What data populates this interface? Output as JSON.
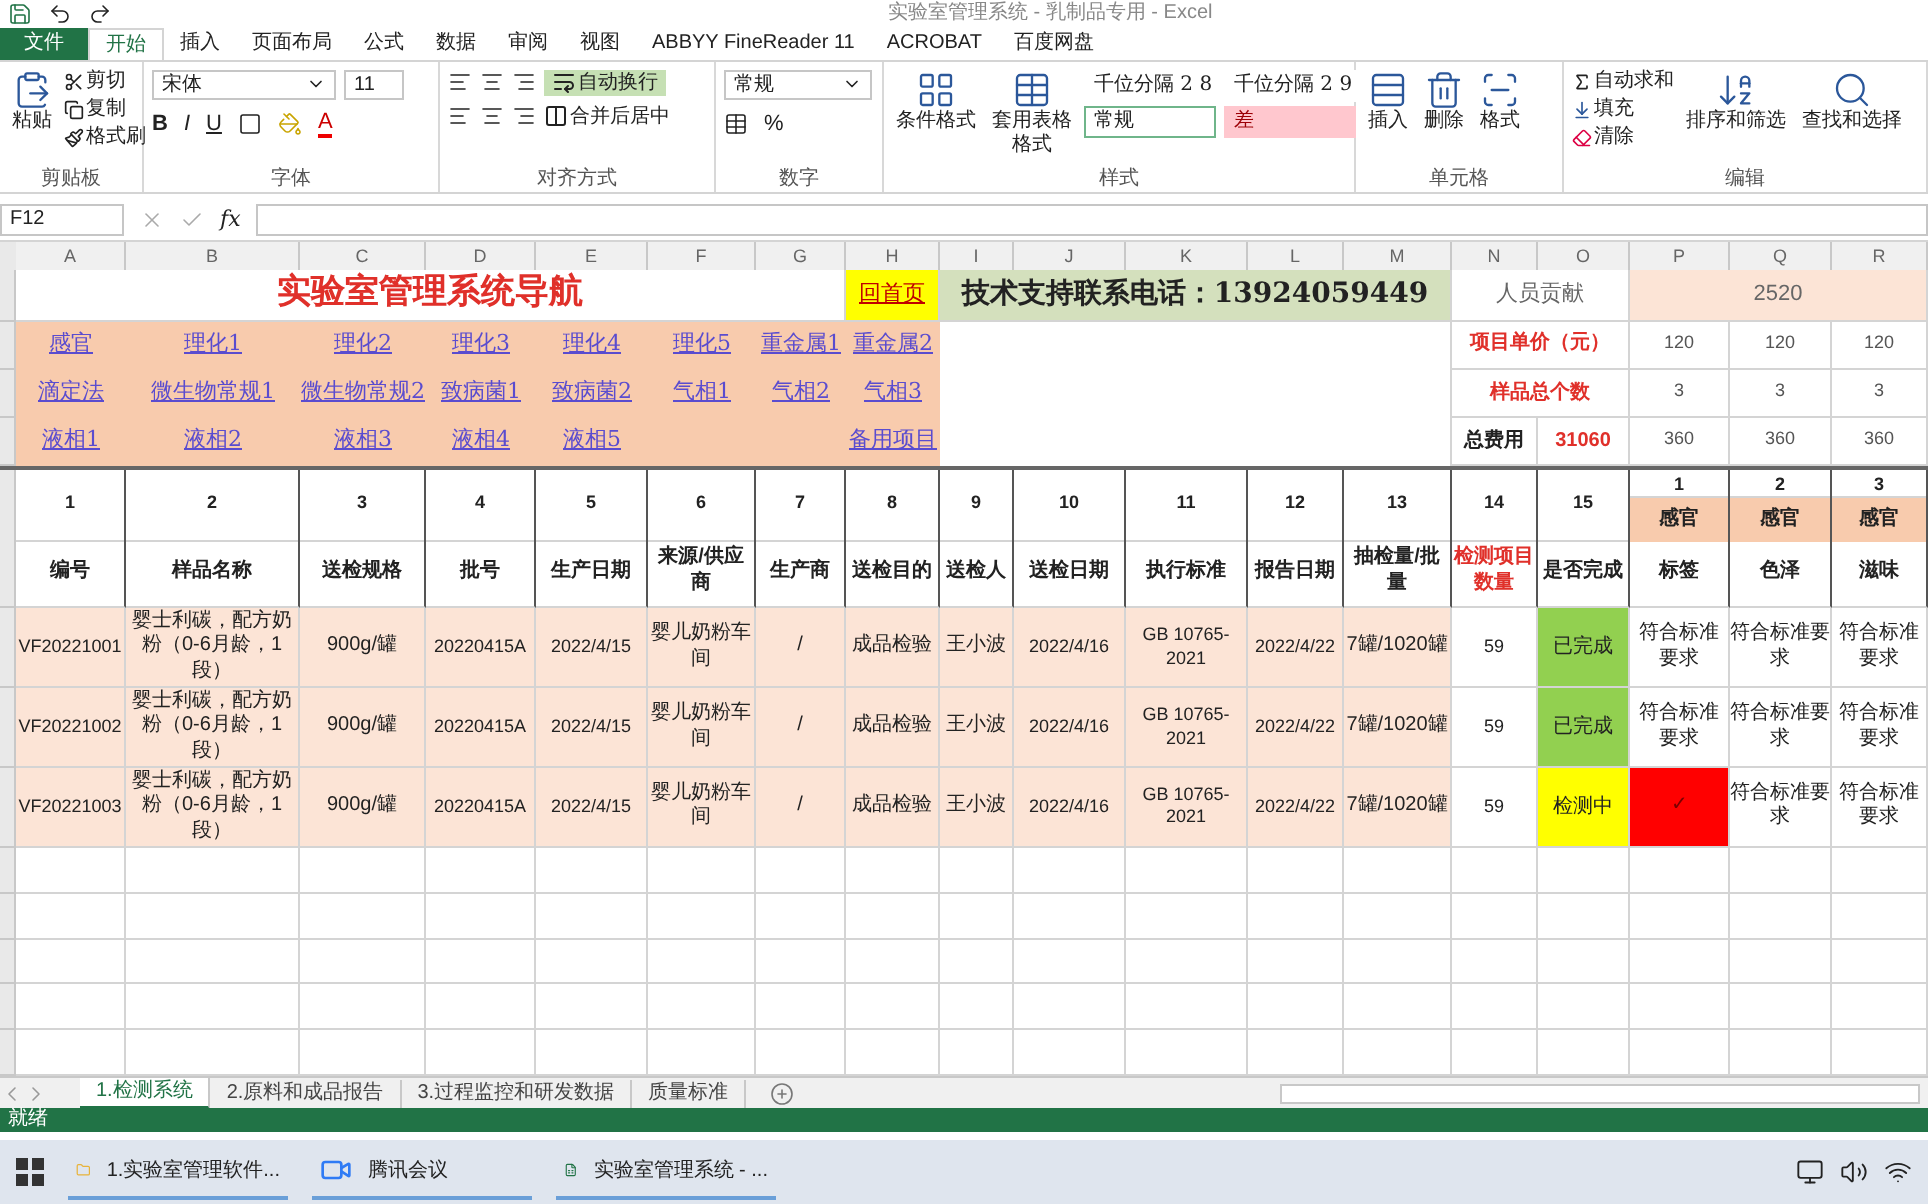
{
  "window": {
    "title": "实验室管理系统 - 乳制品专用 - Excel"
  },
  "ribbon_tabs": [
    {
      "label": "文件",
      "kind": "file",
      "selected": false
    },
    {
      "label": "开始",
      "kind": "tab",
      "selected": true
    },
    {
      "label": "插入",
      "kind": "tab",
      "selected": false
    },
    {
      "label": "页面布局",
      "kind": "tab",
      "selected": false
    },
    {
      "label": "公式",
      "kind": "tab",
      "selected": false
    },
    {
      "label": "数据",
      "kind": "tab",
      "selected": false
    },
    {
      "label": "审阅",
      "kind": "tab",
      "selected": false
    },
    {
      "label": "视图",
      "kind": "tab",
      "selected": false
    },
    {
      "label": "ABBYY FineReader 11",
      "kind": "tab",
      "selected": false
    },
    {
      "label": "ACROBAT",
      "kind": "tab",
      "selected": false
    },
    {
      "label": "百度网盘",
      "kind": "tab",
      "selected": false
    }
  ],
  "ribbon": {
    "clipboard": {
      "label": "剪贴板",
      "paste": "粘贴",
      "cut": "剪切",
      "copy": "复制",
      "format_painter": "格式刷"
    },
    "font": {
      "label": "字体",
      "name": "宋体",
      "size": "11",
      "bold": "B",
      "italic": "I",
      "underline": "U",
      "color_letter": "A"
    },
    "alignment": {
      "label": "对齐方式",
      "wrap": "自动换行",
      "wrap_on": true,
      "merge": "合并后居中"
    },
    "number": {
      "label": "数字",
      "format": "常规",
      "percent": "%"
    },
    "styles": {
      "label": "样式",
      "conditional": "条件格式",
      "table": "套用表格格式",
      "cell_styles": [
        {
          "text": "千位分隔 2 8",
          "kind": "plain"
        },
        {
          "text": "千位分隔 2 9",
          "kind": "plain"
        },
        {
          "text": "常规",
          "kind": "normal"
        },
        {
          "text": "差",
          "kind": "bad"
        }
      ]
    },
    "cells": {
      "label": "单元格",
      "insert": "插入",
      "delete": "删除",
      "format": "格式"
    },
    "editing": {
      "label": "编辑",
      "autosum": "自动求和",
      "fill": "填充",
      "clear": "清除",
      "sort": "排序和筛选",
      "find": "查找和选择"
    }
  },
  "formula_bar": {
    "name_box": "F12",
    "fx": "fx"
  },
  "columns": [
    "A",
    "B",
    "C",
    "D",
    "E",
    "F",
    "G",
    "H",
    "I",
    "J",
    "K",
    "L",
    "M",
    "N",
    "O",
    "P",
    "Q",
    "R"
  ],
  "sheet": {
    "title": "实验室管理系统导航",
    "home_link": "回首页",
    "support": "技术支持联系电话：13924059449",
    "contribution_label": "人员贡献",
    "contribution_value": "2520",
    "nav_rows": [
      [
        "感官",
        "理化1",
        "理化2",
        "理化3",
        "理化4",
        "理化5",
        "重金属1",
        "重金属2"
      ],
      [
        "滴定法",
        "微生物常规1",
        "微生物常规2",
        "致病菌1",
        "致病菌2",
        "气相1",
        "气相2",
        "气相3"
      ],
      [
        "液相1",
        "液相2",
        "液相3",
        "液相4",
        "液相5",
        "备用项目"
      ]
    ],
    "price_label": "项目单价（元）",
    "count_label": "样品总个数",
    "total_label": "总费用",
    "total_value": "31060",
    "prices": [
      "120",
      "120",
      "120"
    ],
    "counts": [
      "3",
      "3",
      "3"
    ],
    "totals": [
      "360",
      "360",
      "360"
    ],
    "numbers": [
      "1",
      "2",
      "3",
      "4",
      "5",
      "6",
      "7",
      "8",
      "9",
      "10",
      "11",
      "12",
      "13",
      "14",
      "15"
    ],
    "test_items": [
      {
        "number": "1",
        "group": "感官"
      },
      {
        "number": "2",
        "group": "感官"
      },
      {
        "number": "3",
        "group": "感官"
      }
    ],
    "headers": [
      {
        "label": "编号",
        "highlighted": false
      },
      {
        "label": "样品名称",
        "highlighted": false
      },
      {
        "label": "送检规格",
        "highlighted": false
      },
      {
        "label": "批号",
        "highlighted": false
      },
      {
        "label": "生产日期",
        "highlighted": false
      },
      {
        "label": "来源/供应商",
        "highlighted": false
      },
      {
        "label": "生产商",
        "highlighted": false
      },
      {
        "label": "送检目的",
        "highlighted": false
      },
      {
        "label": "送检人",
        "highlighted": false
      },
      {
        "label": "送检日期",
        "highlighted": false
      },
      {
        "label": "执行标准",
        "highlighted": false
      },
      {
        "label": "报告日期",
        "highlighted": false
      },
      {
        "label": "抽检量/批量",
        "highlighted": false
      },
      {
        "label": "检测项目数量",
        "highlighted": true
      },
      {
        "label": "是否完成",
        "highlighted": false
      },
      {
        "label": "标签",
        "highlighted": false
      },
      {
        "label": "色泽",
        "highlighted": false
      },
      {
        "label": "滋味",
        "highlighted": false
      }
    ],
    "rows": [
      {
        "cells": [
          "VF20221001",
          "婴士利碳，配方奶粉（0-6月龄，1段）",
          "900g/罐",
          "20220415A",
          "2022/4/15",
          "婴儿奶粉车间",
          "/",
          "成品检验",
          "王小波",
          "2022/4/16",
          "GB 10765-2021",
          "2022/4/22",
          "7罐/1020罐"
        ],
        "count": "59",
        "status": {
          "text": "已完成",
          "color": "#92d050"
        },
        "results": [
          {
            "text": "符合标准要求",
            "flagged": false
          },
          {
            "text": "符合标准要求",
            "flagged": false
          },
          {
            "text": "符合标准要求",
            "flagged": false
          }
        ]
      },
      {
        "cells": [
          "VF20221002",
          "婴士利碳，配方奶粉（0-6月龄，1段）",
          "900g/罐",
          "20220415A",
          "2022/4/15",
          "婴儿奶粉车间",
          "/",
          "成品检验",
          "王小波",
          "2022/4/16",
          "GB 10765-2021",
          "2022/4/22",
          "7罐/1020罐"
        ],
        "count": "59",
        "status": {
          "text": "已完成",
          "color": "#92d050"
        },
        "results": [
          {
            "text": "符合标准要求",
            "flagged": false
          },
          {
            "text": "符合标准要求",
            "flagged": false
          },
          {
            "text": "符合标准要求",
            "flagged": false
          }
        ]
      },
      {
        "cells": [
          "VF20221003",
          "婴士利碳，配方奶粉（0-6月龄，1段）",
          "900g/罐",
          "20220415A",
          "2022/4/15",
          "婴儿奶粉车间",
          "/",
          "成品检验",
          "王小波",
          "2022/4/16",
          "GB 10765-2021",
          "2022/4/22",
          "7罐/1020罐"
        ],
        "count": "59",
        "status": {
          "text": "检测中",
          "color": "#ffff00"
        },
        "results": [
          {
            "text": "✓",
            "flagged": true
          },
          {
            "text": "符合标准要求",
            "flagged": false
          },
          {
            "text": "符合标准要求",
            "flagged": false
          }
        ]
      }
    ]
  },
  "sheet_tabs": [
    {
      "label": "1.检测系统",
      "selected": true
    },
    {
      "label": "2.原料和成品报告",
      "selected": false
    },
    {
      "label": "3.过程监控和研发数据",
      "selected": false
    },
    {
      "label": "质量标准",
      "selected": false
    }
  ],
  "status_bar": {
    "text": "就绪"
  },
  "taskbar": [
    {
      "label": "1.实验室管理软件...",
      "kind": "folder"
    },
    {
      "label": "腾讯会议",
      "kind": "meeting"
    },
    {
      "label": "实验室管理系统 - ...",
      "kind": "excel"
    }
  ]
}
